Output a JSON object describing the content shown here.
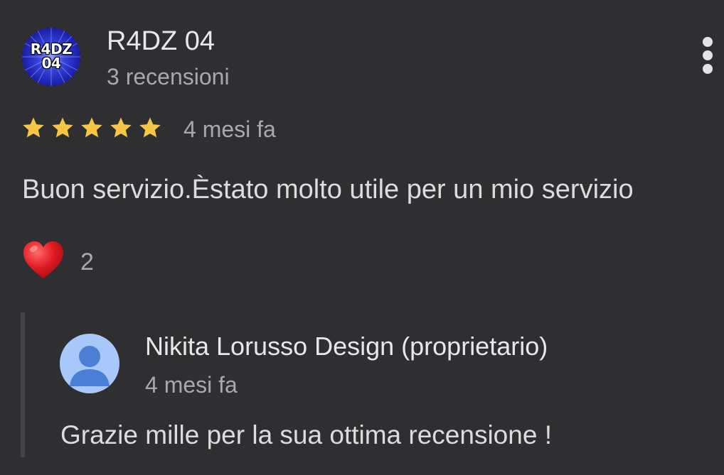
{
  "review": {
    "author": {
      "name": "R4DZ 04",
      "avatar_text_line1": "R4DZ",
      "avatar_text_line2": "04",
      "review_count": "3 recensioni"
    },
    "rating": 5,
    "rating_max": 5,
    "time_ago": "4 mesi fa",
    "text": "Buon servizio.Èstato molto utile per un mio servizio",
    "reaction": {
      "icon": "heart-icon",
      "count": "2"
    },
    "menu_icon": "more-vertical-icon"
  },
  "owner_reply": {
    "name": "Nikita Lorusso Design (proprietario)",
    "time_ago": "4 mesi fa",
    "text": "Grazie mille per la sua ottima recensione !",
    "avatar_icon": "default-person-icon"
  },
  "colors": {
    "background": "#2f2f31",
    "star": "#f6c644",
    "heart": "#e01b24",
    "owner_avatar_bg": "#a8c7fa",
    "owner_avatar_fg": "#4b7fd6"
  }
}
